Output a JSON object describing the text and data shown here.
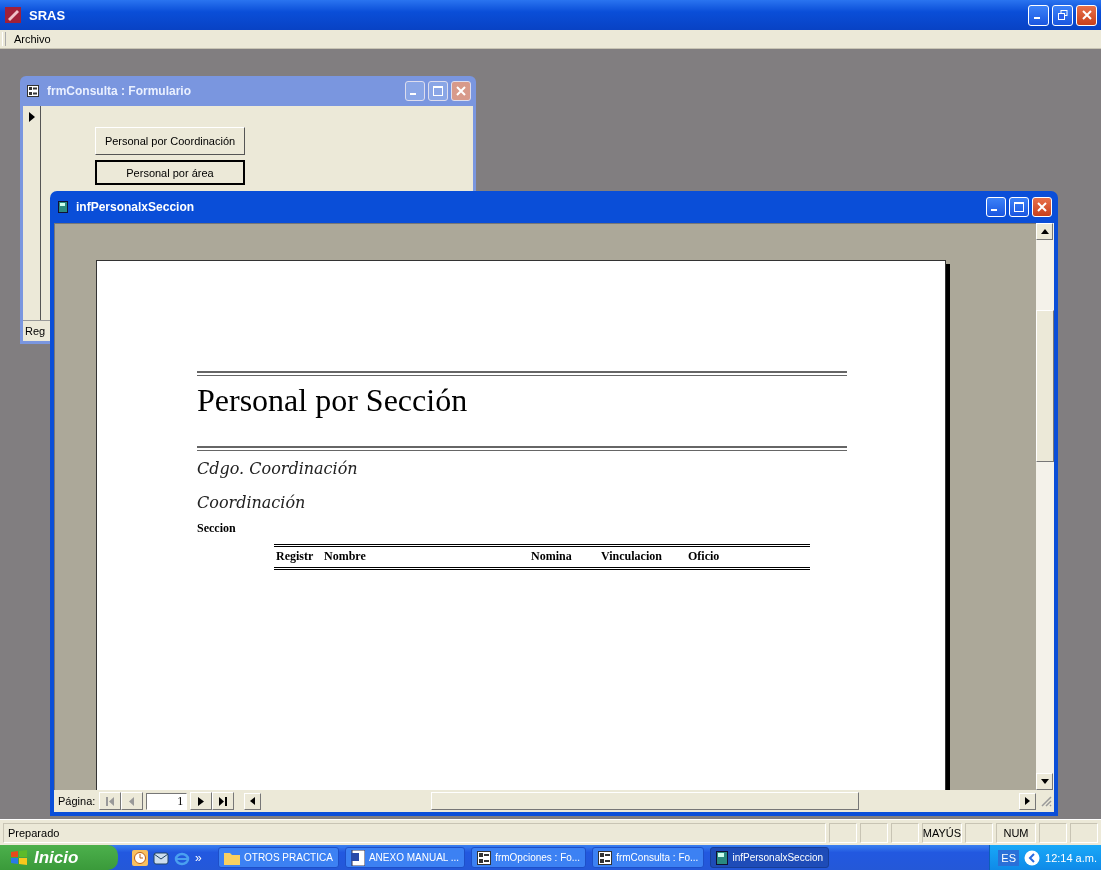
{
  "window": {
    "title": "SRAS"
  },
  "menu": [
    {
      "label": "Archivo"
    }
  ],
  "form_window": {
    "title": "frmConsulta : Formulario",
    "buttons": [
      {
        "label": "Personal por Coordinación",
        "selected": false
      },
      {
        "label": "Personal por área",
        "selected": true
      }
    ],
    "record_label": "Reg"
  },
  "report_window": {
    "title": "infPersonalxSeccion",
    "report": {
      "title": "Personal por Sección",
      "fields": [
        "Cdgo. Coordinación",
        "Coordinación"
      ],
      "group_label": "Seccion",
      "columns": [
        "Registr",
        "Nombre",
        "Nomina",
        "Vinculacion",
        "Oficio"
      ]
    },
    "navigation": {
      "label": "Página:",
      "page": "1"
    }
  },
  "status_bar": {
    "text": "Preparado",
    "indicators": [
      "MAYÚS",
      "NUM"
    ]
  },
  "taskbar": {
    "start": "Inicio",
    "overflow": "»",
    "tasks": [
      {
        "label": "OTROS PRACTICA",
        "kind": "folder",
        "selected": false
      },
      {
        "label": "ANEXO MANUAL ...",
        "kind": "document",
        "selected": false
      },
      {
        "label": "frmOpciones : Fo...",
        "kind": "form",
        "selected": false
      },
      {
        "label": "frmConsulta : Fo...",
        "kind": "form",
        "selected": false
      },
      {
        "label": "infPersonalxSeccion",
        "kind": "report",
        "selected": true
      }
    ],
    "language": "ES",
    "clock": "12:14 a.m."
  }
}
